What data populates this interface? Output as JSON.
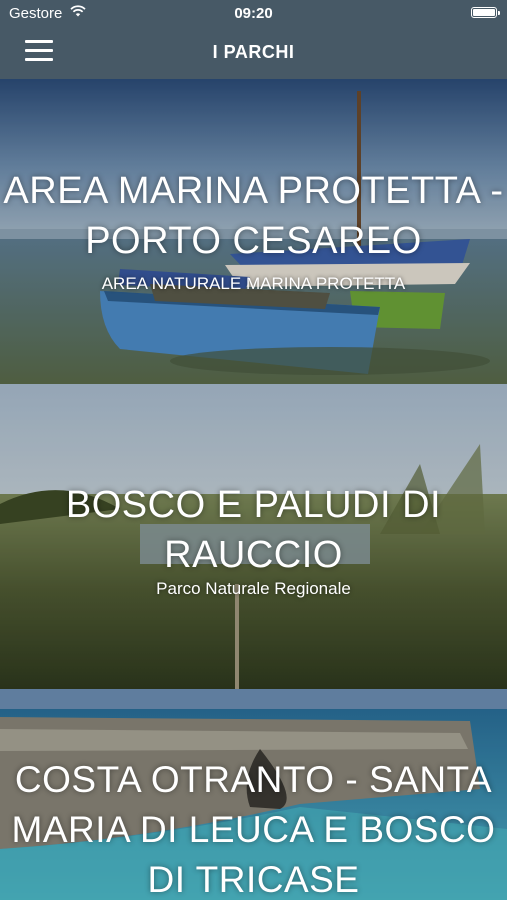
{
  "status_bar": {
    "carrier": "Gestore",
    "time": "09:20"
  },
  "header": {
    "title": "I PARCHI"
  },
  "parks": [
    {
      "name": "AREA MARINA PROTETTA - PORTO CESAREO",
      "category": "AREA NATURALE MARINA PROTETTA"
    },
    {
      "name": "BOSCO E PALUDI DI RAUCCIO",
      "category": "Parco Naturale Regionale"
    },
    {
      "name": "COSTA OTRANTO - SANTA MARIA DI LEUCA E BOSCO DI TRICASE",
      "category": ""
    }
  ],
  "colors": {
    "header_bg": "#475966",
    "text": "#ffffff"
  }
}
